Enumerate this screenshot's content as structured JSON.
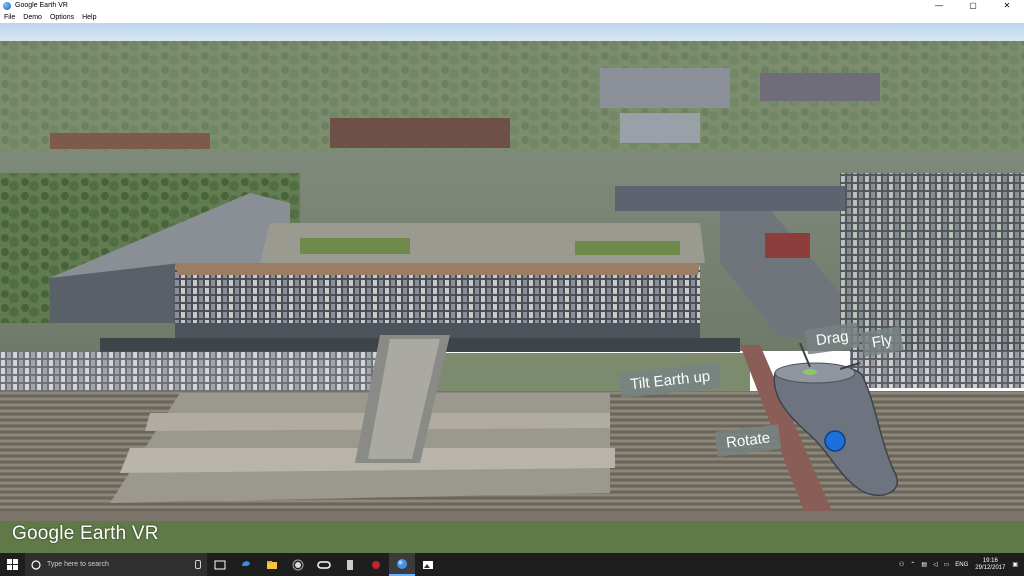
{
  "window": {
    "title": "Google Earth VR",
    "minimize": "—",
    "maximize": "▢",
    "close": "✕"
  },
  "menu": [
    "File",
    "Demo",
    "Options",
    "Help"
  ],
  "vr_controller": {
    "labels": {
      "drag": "Drag",
      "fly": "Fly",
      "tilt": "Tilt Earth up",
      "rotate": "Rotate"
    }
  },
  "logo": "Google Earth VR",
  "taskbar": {
    "search_placeholder": "Type here to search",
    "icons": [
      "task-view-icon",
      "edge-icon",
      "file-explorer-icon",
      "app-icon-1",
      "oculus-icon",
      "app-icon-2",
      "app-icon-3",
      "google-earth-vr-icon",
      "photos-icon"
    ],
    "language": "ENG",
    "time": "19:16",
    "date": "29/12/2017"
  }
}
